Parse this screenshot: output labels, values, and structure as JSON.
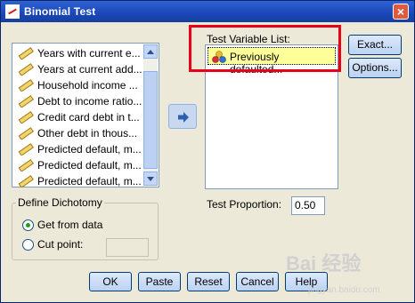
{
  "window": {
    "title": "Binomial Test",
    "close_label": "×"
  },
  "source_list": {
    "items": [
      "Years with current e...",
      "Years at current add...",
      "Household income ...",
      "Debt to income ratio...",
      "Credit card debt in t...",
      "Other debt in thous...",
      "Predicted default, m...",
      "Predicted default, m...",
      "Predicted default, m..."
    ]
  },
  "test_variable_list": {
    "label": "Test Variable List:",
    "items": [
      "Previously defaulted..."
    ]
  },
  "test_proportion": {
    "label": "Test Proportion:",
    "value": "0.50"
  },
  "define_dichotomy": {
    "legend": "Define Dichotomy",
    "get_from_data": "Get from data",
    "cut_point": "Cut point:",
    "cut_point_value": "",
    "selected": "get_from_data"
  },
  "buttons": {
    "exact": "Exact...",
    "options": "Options...",
    "ok": "OK",
    "paste": "Paste",
    "reset": "Reset",
    "cancel": "Cancel",
    "help": "Help"
  },
  "watermark": {
    "text": "Bai 经验",
    "url": "jingyan.baidu.com"
  },
  "colors": {
    "highlight": "#e8001a",
    "titlebar": "#1a47b8",
    "selected_item": "#ffff99"
  }
}
